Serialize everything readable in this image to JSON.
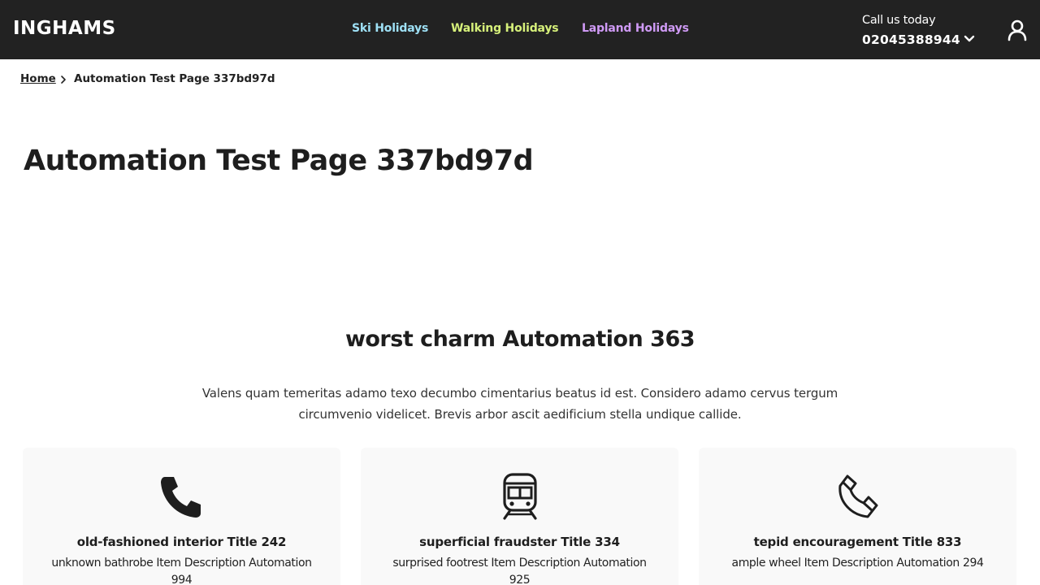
{
  "header": {
    "logo": "INGHAMS",
    "nav": [
      {
        "label": "Ski Holidays",
        "color": "#9ee0f5"
      },
      {
        "label": "Walking Holidays",
        "color": "#d6f07a"
      },
      {
        "label": "Lapland Holidays",
        "color": "#cf9af5"
      }
    ],
    "call_label": "Call us today",
    "call_number": "02045388944",
    "icons": {
      "chevron": "chevron-down-icon",
      "account": "user-icon"
    }
  },
  "breadcrumb": {
    "home": "Home",
    "current": "Automation Test Page 337bd97d"
  },
  "page_title": "Automation Test Page 337bd97d",
  "section": {
    "title": "worst charm Automation 363",
    "description": "Valens quam temeritas adamo texo decumbo cimentarius beatus id est. Considero adamo cervus tergum circumvenio videlicet. Brevis arbor ascit aedificium stella undique callide."
  },
  "cards": [
    {
      "icon": "phone-icon",
      "title": "old-fashioned interior Title 242",
      "description": "unknown bathrobe Item Description Automation 994"
    },
    {
      "icon": "train-icon",
      "title": "superficial fraudster Title 334",
      "description": "surprised footrest Item Description Automation 925"
    },
    {
      "icon": "phone-outline-icon",
      "title": "tepid encouragement Title 833",
      "description": "ample wheel Item Description Automation 294"
    }
  ],
  "colors": {
    "header_bg": "#222222",
    "card_bg": "#f9f9f9",
    "text": "#1e1e1e"
  }
}
